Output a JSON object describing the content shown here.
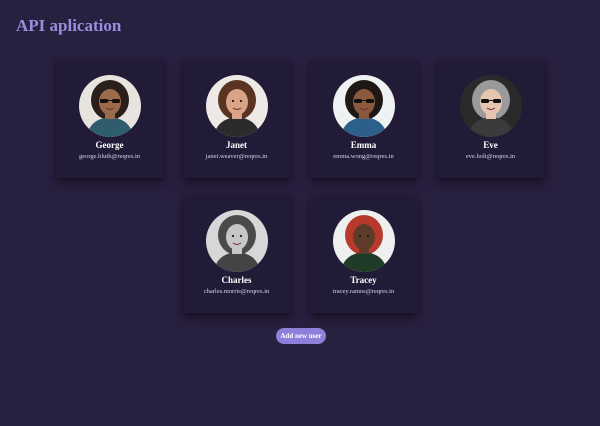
{
  "header": {
    "title": "API aplication"
  },
  "users": [
    {
      "name": "George",
      "email": "george.bluth@reqres.in",
      "skin": "#9b6b4c",
      "hair": "#2a1f1a",
      "bg": "#e7e3de",
      "shirt": "#2f5d6d",
      "glasses": true
    },
    {
      "name": "Janet",
      "email": "janet.weaver@reqres.in",
      "skin": "#d9a488",
      "hair": "#5a3420",
      "bg": "#ece9e6",
      "shirt": "#2b2b2b",
      "glasses": false
    },
    {
      "name": "Emma",
      "email": "emma.wong@reqres.in",
      "skin": "#8b5a3e",
      "hair": "#1f1713",
      "bg": "#eef2f3",
      "shirt": "#2c5f8a",
      "glasses": true
    },
    {
      "name": "Eve",
      "email": "eve.holt@reqres.in",
      "skin": "#e6c5b1",
      "hair": "#9a9a9a",
      "bg": "#2a2a2a",
      "shirt": "#3b3b3b",
      "glasses": true
    },
    {
      "name": "Charles",
      "email": "charles.morris@reqres.in",
      "skin": "#c7c7c7",
      "hair": "#4a4a4a",
      "bg": "#d7d7d7",
      "shirt": "#444444",
      "glasses": false
    },
    {
      "name": "Tracey",
      "email": "tracey.ramos@reqres.in",
      "skin": "#5e3c2a",
      "hair": "#b6392b",
      "bg": "#eef0f0",
      "shirt": "#1f3a26",
      "glasses": false
    }
  ],
  "actions": {
    "add_user_label": "Add new user"
  }
}
